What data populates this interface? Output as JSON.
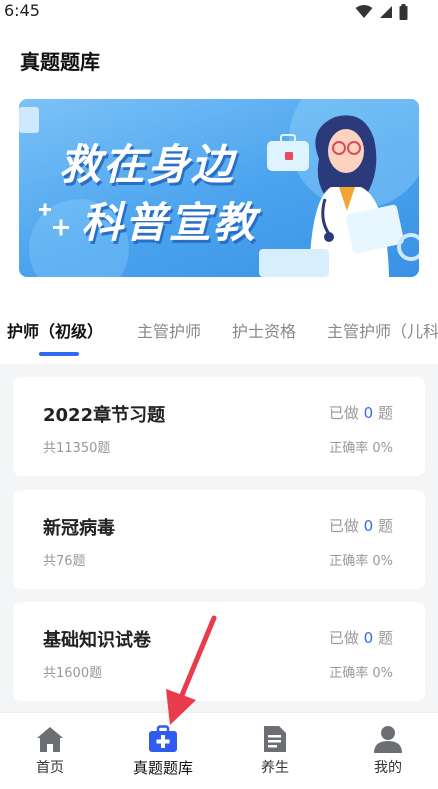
{
  "status_bar": {
    "time": "6:45"
  },
  "header": {
    "title": "真题题库"
  },
  "banner": {
    "line1": "救在身边",
    "line2": "科普宣教"
  },
  "tabs": [
    {
      "label": "护师（初级）",
      "active": true
    },
    {
      "label": "主管护师",
      "active": false
    },
    {
      "label": "护士资格",
      "active": false
    },
    {
      "label": "主管护师（儿科",
      "active": false
    }
  ],
  "cards": [
    {
      "title": "2022章节习题",
      "total": "共11350题",
      "done_prefix": "已做",
      "done_count": "0",
      "done_suffix": "题",
      "accuracy": "正确率 0%"
    },
    {
      "title": "新冠病毒",
      "total": "共76题",
      "done_prefix": "已做",
      "done_count": "0",
      "done_suffix": "题",
      "accuracy": "正确率 0%"
    },
    {
      "title": "基础知识试卷",
      "total": "共1600题",
      "done_prefix": "已做",
      "done_count": "0",
      "done_suffix": "题",
      "accuracy": "正确率 0%"
    }
  ],
  "bottom_nav": [
    {
      "label": "首页",
      "icon": "home-icon",
      "active": false
    },
    {
      "label": "真题题库",
      "icon": "medical-kit-icon",
      "active": true
    },
    {
      "label": "养生",
      "icon": "document-icon",
      "active": false
    },
    {
      "label": "我的",
      "icon": "user-icon",
      "active": false
    }
  ],
  "colors": {
    "accent": "#2f6bf2",
    "banner": "#4aa3ee",
    "annotation_arrow": "#ea3b4a"
  }
}
